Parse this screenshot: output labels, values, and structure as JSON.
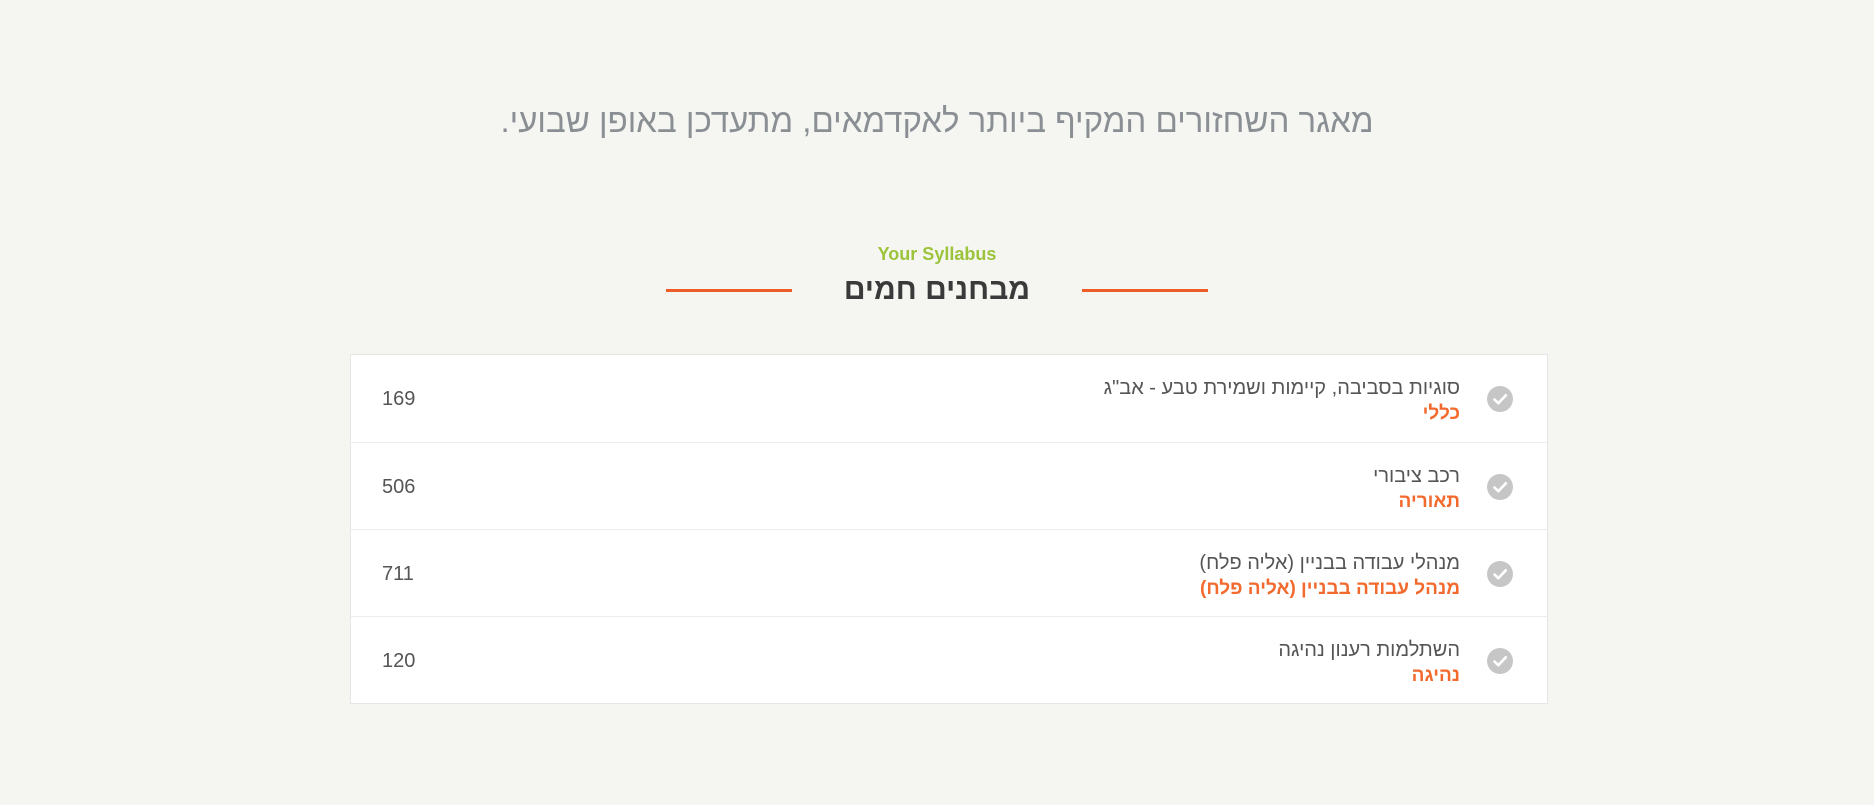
{
  "hero": {
    "tagline": "מאגר השחזורים המקיף ביותר לאקדמאים, מתעדכן באופן שבועי."
  },
  "section": {
    "eyebrow": "Your Syllabus",
    "title": "מבחנים חמים"
  },
  "colors": {
    "accent": "#ef5b25",
    "eyebrow": "#9cc43a",
    "background": "#f5f5f2",
    "check": "#c6c6c6"
  },
  "exams": [
    {
      "title": "סוגיות בסביבה, קיימות ושמירת טבע - אב\"ג",
      "category": "כללי",
      "count": "169",
      "icon": "check-icon"
    },
    {
      "title": "רכב ציבורי",
      "category": "תאוריה",
      "count": "506",
      "icon": "check-icon"
    },
    {
      "title": "מנהלי עבודה בבניין (אליה פלח)",
      "category": "מנהל עבודה בבניין (אליה פלח)",
      "count": "711",
      "icon": "check-icon"
    },
    {
      "title": "השתלמות רענון נהיגה",
      "category": "נהיגה",
      "count": "120",
      "icon": "check-icon"
    }
  ]
}
